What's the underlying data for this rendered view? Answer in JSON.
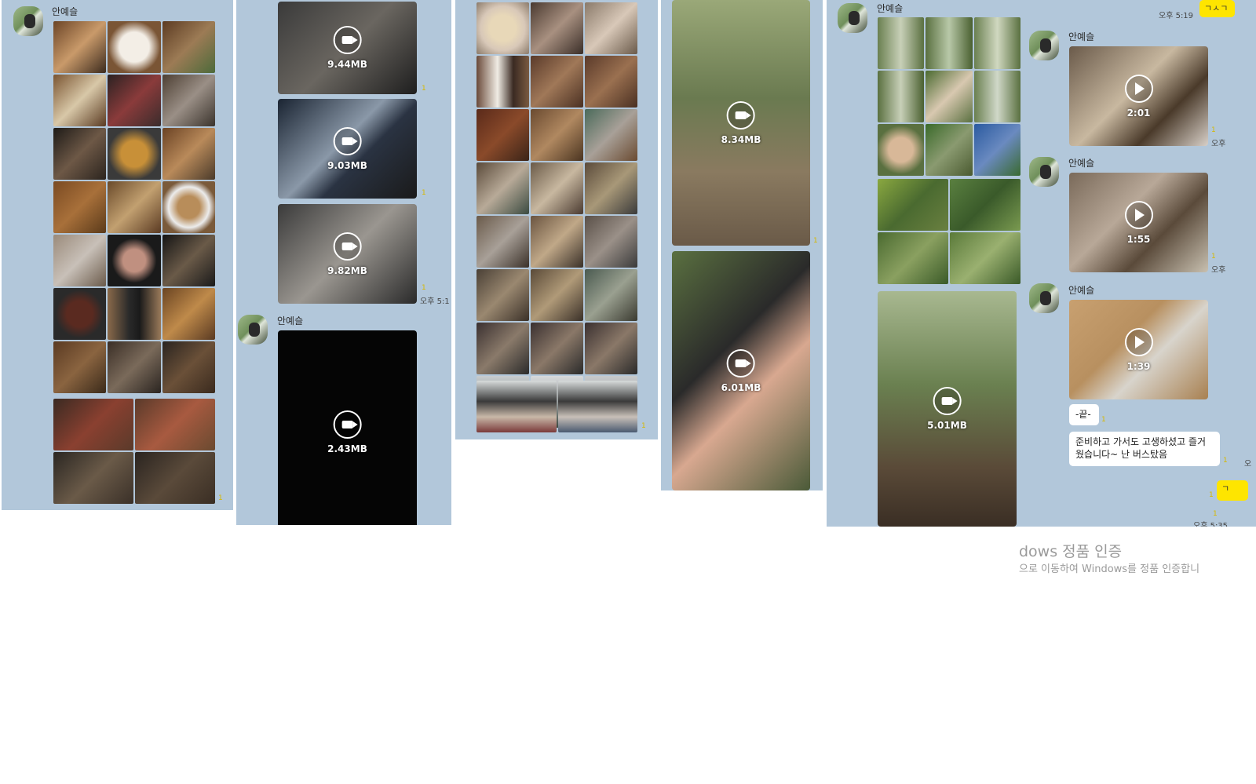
{
  "sender_name": "안예슬",
  "panel1": {
    "sender": "안예슬"
  },
  "panel2": {
    "videos": [
      {
        "size": "9.44MB"
      },
      {
        "size": "9.03MB"
      },
      {
        "size": "9.82MB"
      }
    ],
    "time": "오후 5:1",
    "sender": "안예슬",
    "last_video": {
      "size": "2.43MB"
    }
  },
  "panel4": {
    "videos": [
      {
        "size": "8.34MB"
      },
      {
        "size": "6.01MB"
      }
    ]
  },
  "panel5": {
    "sender_top": "안예슬",
    "time_top": "오후 5:19",
    "yellow_top": "ㄱㅅㄱ",
    "messages": [
      {
        "sender": "안예슬",
        "duration": "2:01",
        "time": "오후"
      },
      {
        "sender": "안예슬",
        "duration": "1:55",
        "time": "오후"
      },
      {
        "sender": "안예슬",
        "duration": "1:39"
      }
    ],
    "big_video": {
      "size": "5.01MB"
    },
    "text1": "-끝-",
    "text2": "준비하고 가서도 고생하셨고 즐거웠습니다~ 난 버스탔음",
    "yellow_bottom": "ㄱ",
    "time_bottom": "오후 5:35",
    "time_side": "오"
  },
  "watermark": {
    "line1": "dows 정품 인증",
    "line2": "으로 이동하여 Windows를 정품 인증합니"
  }
}
